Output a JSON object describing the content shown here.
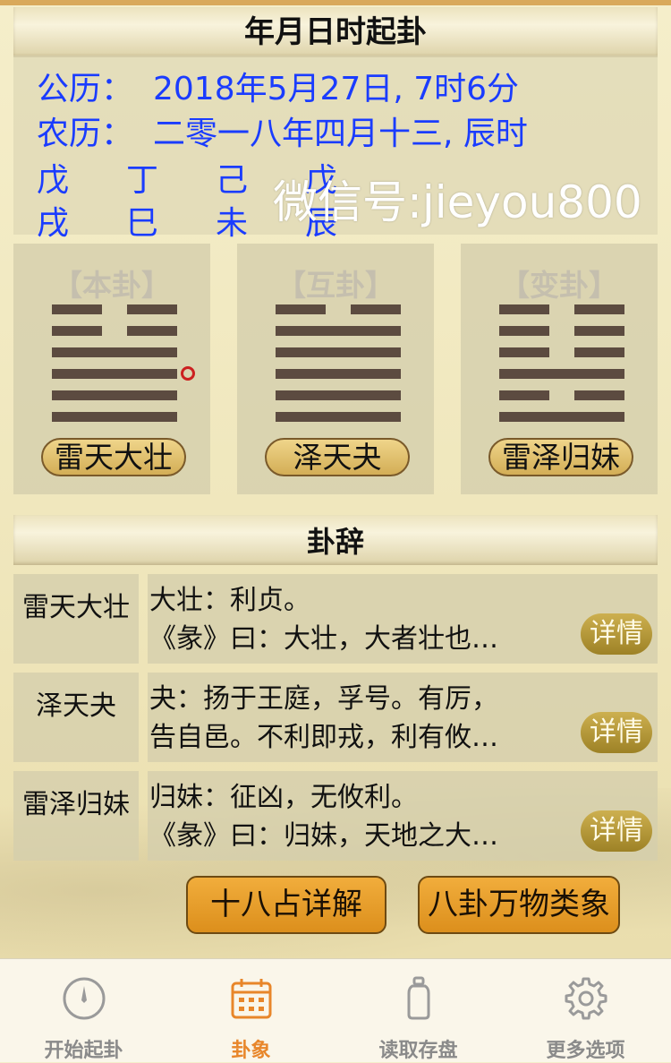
{
  "header": {
    "title": "年月日时起卦"
  },
  "info": {
    "solar_label": "公历：",
    "solar_value": "2018年5月27日, 7时6分",
    "lunar_label": "农历：",
    "lunar_value": "二零一八年四月十三, 辰时",
    "stems": [
      "戊",
      "丁",
      "己",
      "戊"
    ],
    "branches": [
      "戌",
      "巳",
      "未",
      "辰"
    ]
  },
  "watermark": "微信号:jieyou800",
  "hexagrams": [
    {
      "title": "【本卦】",
      "name": "雷天大壮",
      "lines_top_to_bottom": [
        "yin",
        "yin",
        "yang",
        "yang",
        "yang",
        "yang"
      ],
      "moving_line": 3
    },
    {
      "title": "【互卦】",
      "name": "泽天夬",
      "lines_top_to_bottom": [
        "yin",
        "yang",
        "yang",
        "yang",
        "yang",
        "yang"
      ]
    },
    {
      "title": "【变卦】",
      "name": "雷泽归妹",
      "lines_top_to_bottom": [
        "yin",
        "yin",
        "yin",
        "yang",
        "yin",
        "yang"
      ]
    }
  ],
  "guaci": {
    "title": "卦辞",
    "rows": [
      {
        "name": "雷天大壮",
        "line1": "大壮：利贞。",
        "line2": "《彖》曰：大壮，大者壮也…",
        "button": "详情"
      },
      {
        "name": "泽天夬",
        "line1": "夬：扬于王庭，孚号。有厉，",
        "line2": "告自邑。不利即戎，利有攸…",
        "button": "详情"
      },
      {
        "name": "雷泽归妹",
        "line1": "归妹：征凶，无攸利。",
        "line2": "《彖》曰：归妹，天地之大…",
        "button": "详情"
      }
    ]
  },
  "actions": {
    "shiba": "十八占详解",
    "bagua": "八卦万物类象"
  },
  "tabs": [
    {
      "label": "开始起卦",
      "icon": "compass-icon"
    },
    {
      "label": "卦象",
      "icon": "calendar-icon",
      "active": true
    },
    {
      "label": "读取存盘",
      "icon": "bottle-icon"
    },
    {
      "label": "更多选项",
      "icon": "gear-icon"
    }
  ],
  "colors": {
    "accent": "#e8862a",
    "info_text": "#1a3cff",
    "button": "#dc8f1c",
    "line": "#5c4b40"
  }
}
